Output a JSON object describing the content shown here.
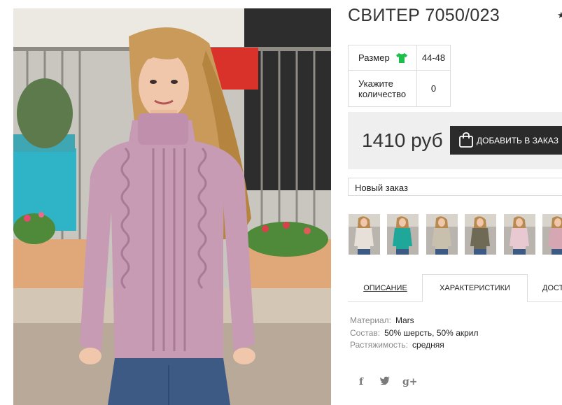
{
  "product": {
    "title": "СВИТЕР 7050/023",
    "size_label": "Размер",
    "size_value": "44-48",
    "qty_label": "Укажите количество",
    "qty_value": "0",
    "price": "1410 руб",
    "cart_button": "ДОБАВИТЬ В ЗАКАЗ",
    "order_select": "Новый заказ"
  },
  "thumbnails": [
    {
      "name": "thumb-1",
      "sweater_color": "#e6e0d8"
    },
    {
      "name": "thumb-2",
      "sweater_color": "#1fa89a"
    },
    {
      "name": "thumb-3",
      "sweater_color": "#c8c0ad"
    },
    {
      "name": "thumb-4",
      "sweater_color": "#6f6a55"
    },
    {
      "name": "thumb-5",
      "sweater_color": "#e8c9d2"
    },
    {
      "name": "thumb-6",
      "sweater_color": "#d6a7b3"
    }
  ],
  "tabs": {
    "description": "ОПИСАНИЕ",
    "characteristics": "ХАРАКТЕРИСТИКИ",
    "delivery": "ДОСТАВКА"
  },
  "characteristics": [
    {
      "key": "Материал:",
      "value": "Mars"
    },
    {
      "key": "Состав:",
      "value": "50% шерсть, 50% акрил"
    },
    {
      "key": "Растяжимость:",
      "value": "средняя"
    }
  ],
  "social": {
    "facebook": "f",
    "twitter": "🐦",
    "googleplus": "g+"
  },
  "colors": {
    "sweater": "#c79bb4",
    "button_bg": "#2b2b2b",
    "price_bg": "#efefef",
    "size_icon": "#1dbf4a"
  },
  "icons": [
    "star-icon",
    "tshirt-icon",
    "shopping-bag-icon",
    "facebook-icon",
    "twitter-icon",
    "google-plus-icon"
  ]
}
